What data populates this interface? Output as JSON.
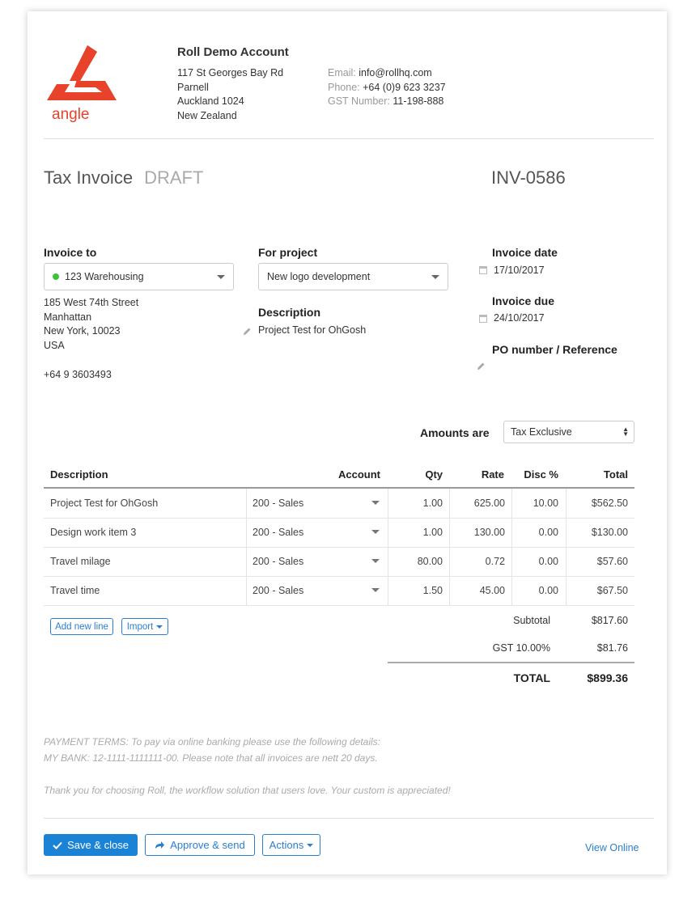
{
  "company": {
    "brand": "angle",
    "brand_color": "#e8422a",
    "name": "Roll Demo Account",
    "address": [
      "117 St Georges Bay Rd",
      "Parnell",
      "Auckland 1024",
      "New Zealand"
    ],
    "email_label": "Email:",
    "email": "info@rollhq.com",
    "phone_label": "Phone:",
    "phone": "+64 (0)9 623 3237",
    "gst_label": "GST Number:",
    "gst": "11-198-888"
  },
  "header": {
    "title": "Tax Invoice",
    "status": "DRAFT",
    "invoice_number": "INV-0586"
  },
  "invoice_to": {
    "label": "Invoice to",
    "client": "123 Warehousing",
    "client_status_color": "#3cc13c",
    "address": [
      "185 West 74th Street",
      "Manhattan",
      "New York, 10023",
      "USA"
    ],
    "phone": "+64 9 3603493"
  },
  "project": {
    "label": "For project",
    "value": "New logo development",
    "description_label": "Description",
    "description": "Project Test for OhGosh"
  },
  "dates": {
    "invoice_date_label": "Invoice date",
    "invoice_date": "17/10/2017",
    "due_label": "Invoice due",
    "due": "24/10/2017",
    "po_label": "PO number / Reference"
  },
  "amounts": {
    "label": "Amounts are",
    "value": "Tax Exclusive"
  },
  "table": {
    "headers": {
      "description": "Description",
      "account": "Account",
      "qty": "Qty",
      "rate": "Rate",
      "disc": "Disc %",
      "total": "Total"
    },
    "rows": [
      {
        "description": "Project Test for OhGosh",
        "account": "200 - Sales",
        "qty": "1.00",
        "rate": "625.00",
        "disc": "10.00",
        "total": "$562.50"
      },
      {
        "description": "Design work item 3",
        "account": "200 - Sales",
        "qty": "1.00",
        "rate": "130.00",
        "disc": "0.00",
        "total": "$130.00"
      },
      {
        "description": "Travel milage",
        "account": "200 - Sales",
        "qty": "80.00",
        "rate": "0.72",
        "disc": "0.00",
        "total": "$57.60"
      },
      {
        "description": "Travel time",
        "account": "200 - Sales",
        "qty": "1.50",
        "rate": "45.00",
        "disc": "0.00",
        "total": "$67.50"
      }
    ]
  },
  "line_actions": {
    "add_line": "Add new line",
    "import": "Import"
  },
  "totals": {
    "subtotal_label": "Subtotal",
    "subtotal": "$817.60",
    "gst_label": "GST 10.00%",
    "gst": "$81.76",
    "total_label": "TOTAL",
    "total": "$899.36"
  },
  "terms": {
    "line1": "PAYMENT TERMS: To pay via online banking please use the following details:",
    "line2": "MY BANK: 12-1111-1111111-00. Please note that all invoices are nett 20 days.",
    "line3": "Thank you for choosing Roll, the workflow solution that users love. Your custom is appreciated!"
  },
  "footer": {
    "save": "Save & close",
    "approve": "Approve & send",
    "actions": "Actions",
    "view_online": "View Online"
  },
  "colors": {
    "primary": "#1a83d6",
    "link": "#2b7fd0"
  }
}
